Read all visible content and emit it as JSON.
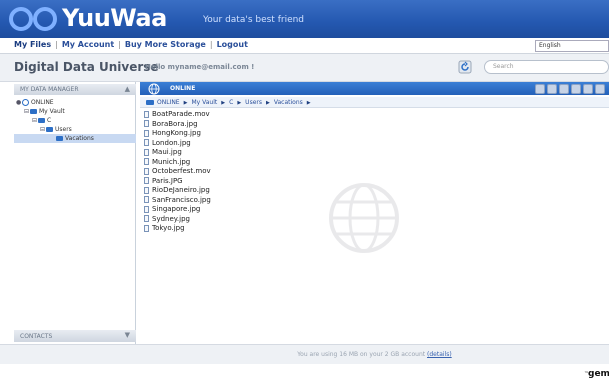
{
  "brand": {
    "name": "YuuWaa",
    "tagline": "Your data's best friend"
  },
  "topnav": {
    "items": [
      "My Files",
      "My Account",
      "Buy More Storage",
      "Logout"
    ],
    "language": "English"
  },
  "subheader": {
    "title": "Digital Data Universe",
    "greeting": "Hello myname@email.com !",
    "search_placeholder": "Search"
  },
  "left_panel": {
    "header": "MY DATA MANAGER",
    "tree": [
      {
        "label": "ONLINE",
        "level": 0,
        "icon": "globe-icon"
      },
      {
        "label": "My Vault",
        "level": 1,
        "icon": "folder-icon"
      },
      {
        "label": "C",
        "level": 2,
        "icon": "folder-icon"
      },
      {
        "label": "Users",
        "level": 3,
        "icon": "folder-icon"
      },
      {
        "label": "Vacations",
        "level": 4,
        "icon": "folder-icon",
        "selected": true
      }
    ],
    "contacts": "CONTACTS"
  },
  "right_panel": {
    "location": "ONLINE",
    "breadcrumb": [
      "ONLINE",
      "My Vault",
      "C",
      "Users",
      "Vacations"
    ],
    "files": [
      "BoatParade.mov",
      "BoraBora.jpg",
      "HongKong.jpg",
      "London.jpg",
      "Maui.jpg",
      "Munich.jpg",
      "Octoberfest.mov",
      "Paris.JPG",
      "RioDeJaneiro.jpg",
      "SanFrancisco.jpg",
      "Singapore.jpg",
      "Sydney.jpg",
      "Tokyo.jpg"
    ]
  },
  "status": {
    "text": "You are using 16 MB on your 2 GB account",
    "link": "(details)"
  },
  "footer": {
    "brand": "gemalto",
    "tm": "™"
  },
  "colors": {
    "header_blue": "#2458b0",
    "accent_blue": "#2d6fc6"
  }
}
